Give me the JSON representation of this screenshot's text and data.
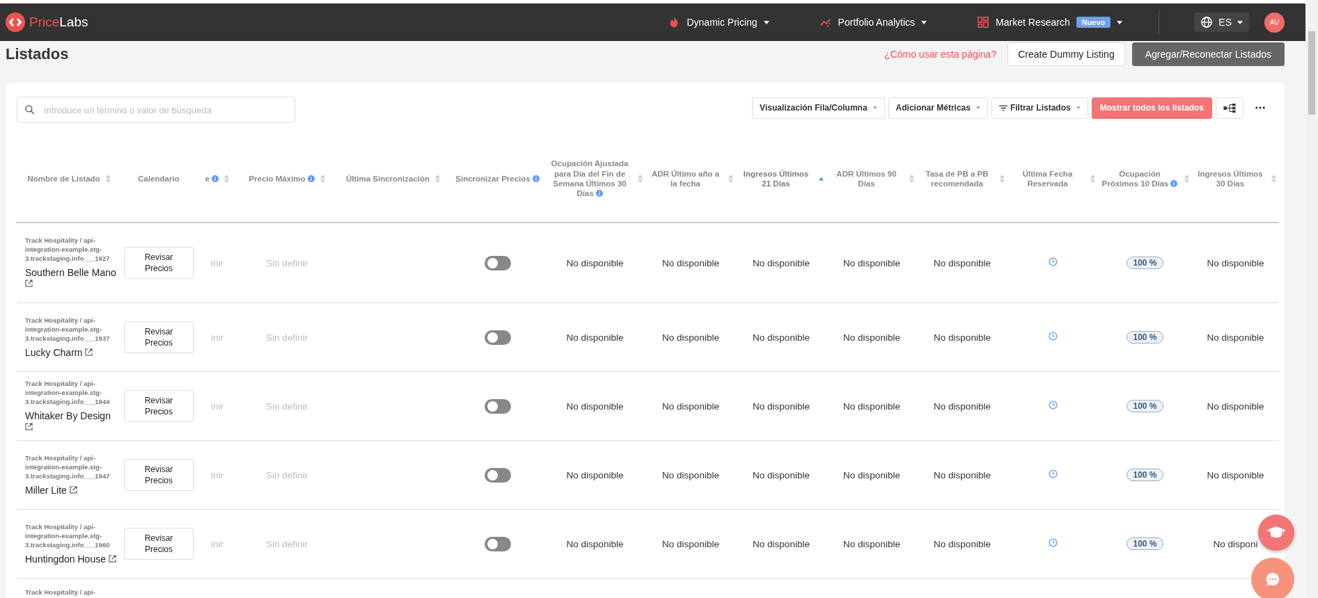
{
  "brand": {
    "parts": [
      "Price",
      "Labs"
    ]
  },
  "nav": [
    {
      "label": "Dynamic Pricing"
    },
    {
      "label": "Portfolio Analytics"
    },
    {
      "label": "Market Research",
      "badge": "Nuevo"
    }
  ],
  "language": "ES",
  "avatar": "AV",
  "page": {
    "title": "Listados",
    "help_link": "¿Cómo usar esta página?",
    "actions": [
      {
        "kind": "secondary",
        "label": "Create Dummy Listing"
      },
      {
        "kind": "dark",
        "label": "Agregar/Reconectar Listados"
      }
    ]
  },
  "search": {
    "placeholder": "Introduce un término o valor de búsqueda"
  },
  "toolbar": [
    {
      "kind": "dropdown",
      "label": "Visualización Fila/Columna"
    },
    {
      "kind": "dropdown",
      "label": "Adicionar Métricas"
    },
    {
      "kind": "filter",
      "label": "Filtrar Listados"
    },
    {
      "kind": "primary",
      "label": "Mostrar todos los listados"
    },
    {
      "kind": "tree"
    },
    {
      "kind": "more"
    }
  ],
  "table": {
    "columns": [
      {
        "label": "Nombre de Listado",
        "info": false,
        "sortable": true,
        "sorted": false
      },
      {
        "label": "Calendario",
        "info": false,
        "sortable": false,
        "sorted": false
      },
      {
        "label": "e",
        "info": true,
        "sortable": true,
        "sorted": false
      },
      {
        "label": "Precio Máximo",
        "info": true,
        "sortable": true,
        "sorted": false
      },
      {
        "label": "Última Sincronización",
        "info": false,
        "sortable": true,
        "sorted": false
      },
      {
        "label": "Sincronizar Precios",
        "info": true,
        "sortable": false,
        "sorted": false
      },
      {
        "label": "Ocupación Ajustada para Día del Fin de Semana Últimos 30 Días",
        "info": true,
        "sortable": true,
        "sorted": false
      },
      {
        "label": "ADR Último año a la fecha",
        "info": false,
        "sortable": true,
        "sorted": false
      },
      {
        "label": "Ingresos Últimos 21 Días",
        "info": false,
        "sortable": true,
        "sorted": true
      },
      {
        "label": "ADR Últimos 90 Días",
        "info": false,
        "sortable": true,
        "sorted": false
      },
      {
        "label": "Tasa de PB a PB recomendada",
        "info": false,
        "sortable": true,
        "sorted": false
      },
      {
        "label": "Última Fecha Reservada",
        "info": false,
        "sortable": true,
        "sorted": false
      },
      {
        "label": "Ocupación Próximos 10 Días",
        "info": true,
        "sortable": true,
        "sorted": false
      },
      {
        "label": "Ingresos Últimos 30 Días",
        "info": false,
        "sortable": true,
        "sorted": false
      }
    ],
    "rows": [
      {
        "source": "Track Hospitality / api-integration-example.stg-3.trackstaging.info___1927",
        "name": "Southern Belle Mano",
        "cells": [
          {
            "kind": "button",
            "text": "Revisar Precios"
          },
          {
            "kind": "muted",
            "text": "inir"
          },
          {
            "kind": "muted",
            "text": "Sin definir"
          },
          null,
          {
            "kind": "toggle",
            "on": false
          },
          {
            "kind": "text",
            "text": "No disponible"
          },
          {
            "kind": "text",
            "text": "No disponible"
          },
          {
            "kind": "text",
            "text": "No disponible"
          },
          {
            "kind": "text",
            "text": "No disponible"
          },
          {
            "kind": "text",
            "text": "No disponible"
          },
          {
            "kind": "clock"
          },
          {
            "kind": "badge",
            "text": "100 %"
          },
          {
            "kind": "text",
            "text": "No disponible"
          }
        ]
      },
      {
        "source": "Track Hospitality / api-integration-example.stg-3.trackstaging.info___1937",
        "name": "Lucky Charm",
        "cells": [
          {
            "kind": "button",
            "text": "Revisar Precios"
          },
          {
            "kind": "muted",
            "text": "inir"
          },
          {
            "kind": "muted",
            "text": "Sin definir"
          },
          null,
          {
            "kind": "toggle",
            "on": false
          },
          {
            "kind": "text",
            "text": "No disponible"
          },
          {
            "kind": "text",
            "text": "No disponible"
          },
          {
            "kind": "text",
            "text": "No disponible"
          },
          {
            "kind": "text",
            "text": "No disponible"
          },
          {
            "kind": "text",
            "text": "No disponible"
          },
          {
            "kind": "clock"
          },
          {
            "kind": "badge",
            "text": "100 %"
          },
          {
            "kind": "text",
            "text": "No disponible"
          }
        ]
      },
      {
        "source": "Track Hospitality / api-integration-example.stg-3.trackstaging.info___1944",
        "name": "Whitaker By Design",
        "cells": [
          {
            "kind": "button",
            "text": "Revisar Precios"
          },
          {
            "kind": "muted",
            "text": "inir"
          },
          {
            "kind": "muted",
            "text": "Sin definir"
          },
          null,
          {
            "kind": "toggle",
            "on": false
          },
          {
            "kind": "text",
            "text": "No disponible"
          },
          {
            "kind": "text",
            "text": "No disponible"
          },
          {
            "kind": "text",
            "text": "No disponible"
          },
          {
            "kind": "text",
            "text": "No disponible"
          },
          {
            "kind": "text",
            "text": "No disponible"
          },
          {
            "kind": "clock"
          },
          {
            "kind": "badge",
            "text": "100 %"
          },
          {
            "kind": "text",
            "text": "No disponible"
          }
        ]
      },
      {
        "source": "Track Hospitality / api-integration-example.stg-3.trackstaging.info___1947",
        "name": "Miller Lite",
        "cells": [
          {
            "kind": "button",
            "text": "Revisar Precios"
          },
          {
            "kind": "muted",
            "text": "inir"
          },
          {
            "kind": "muted",
            "text": "Sin definir"
          },
          null,
          {
            "kind": "toggle",
            "on": false
          },
          {
            "kind": "text",
            "text": "No disponible"
          },
          {
            "kind": "text",
            "text": "No disponible"
          },
          {
            "kind": "text",
            "text": "No disponible"
          },
          {
            "kind": "text",
            "text": "No disponible"
          },
          {
            "kind": "text",
            "text": "No disponible"
          },
          {
            "kind": "clock"
          },
          {
            "kind": "badge",
            "text": "100 %"
          },
          {
            "kind": "text",
            "text": "No disponible"
          }
        ]
      },
      {
        "source": "Track Hospitality / api-integration-example.stg-3.trackstaging.info___1960",
        "name": "Huntingdon House",
        "cells": [
          {
            "kind": "button",
            "text": "Revisar Precios"
          },
          {
            "kind": "muted",
            "text": "inir"
          },
          {
            "kind": "muted",
            "text": "Sin definir"
          },
          null,
          {
            "kind": "toggle",
            "on": false
          },
          {
            "kind": "text",
            "text": "No disponible"
          },
          {
            "kind": "text",
            "text": "No disponible"
          },
          {
            "kind": "text",
            "text": "No disponible"
          },
          {
            "kind": "text",
            "text": "No disponible"
          },
          {
            "kind": "text",
            "text": "No disponible"
          },
          {
            "kind": "clock"
          },
          {
            "kind": "badge",
            "text": "100 %"
          },
          {
            "kind": "text",
            "text": "No disponi"
          }
        ]
      },
      {
        "source": "Track Hospitality / api-"
      }
    ]
  }
}
